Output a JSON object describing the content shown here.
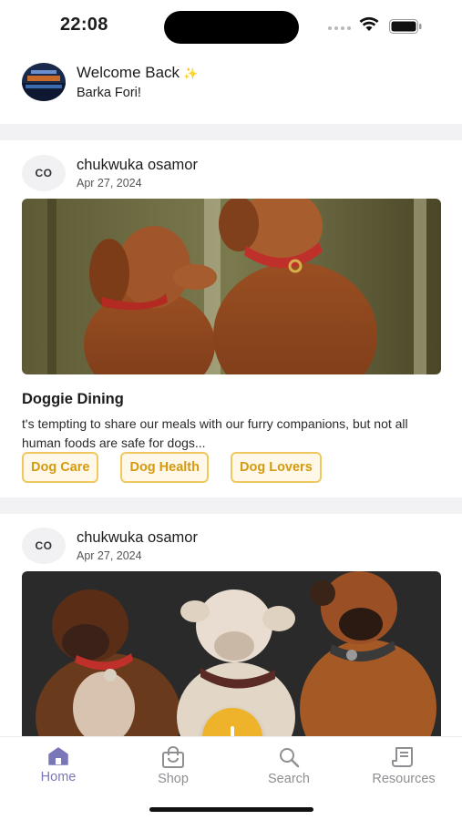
{
  "status_bar": {
    "time": "22:08"
  },
  "welcome": {
    "title": "Welcome Back",
    "sparkle": "✨",
    "name": "Barka Fori!"
  },
  "posts": [
    {
      "avatar_initials": "CO",
      "author": "chukwuka osamor",
      "date": "Apr 27, 2024",
      "title": "Doggie Dining",
      "excerpt": "t's tempting to share our meals with our furry companions, but not all human foods are safe for dogs...",
      "tags": [
        "Dog Care",
        "Dog Health",
        "Dog Lovers"
      ]
    },
    {
      "avatar_initials": "CO",
      "author": "chukwuka osamor",
      "date": "Apr 27, 2024"
    }
  ],
  "fab": {
    "icon": "plus-icon"
  },
  "tab_bar": {
    "items": [
      {
        "label": "Home",
        "icon": "home-icon",
        "active": true
      },
      {
        "label": "Shop",
        "icon": "shopping-bag-icon",
        "active": false
      },
      {
        "label": "Search",
        "icon": "search-icon",
        "active": false
      },
      {
        "label": "Resources",
        "icon": "resources-icon",
        "active": false
      }
    ]
  },
  "colors": {
    "accent": "#eeb32a",
    "tag_text": "#d49a10",
    "tag_border": "#f0c860",
    "active_tab": "#7a77b8",
    "inactive_tab": "#8e8e93"
  }
}
